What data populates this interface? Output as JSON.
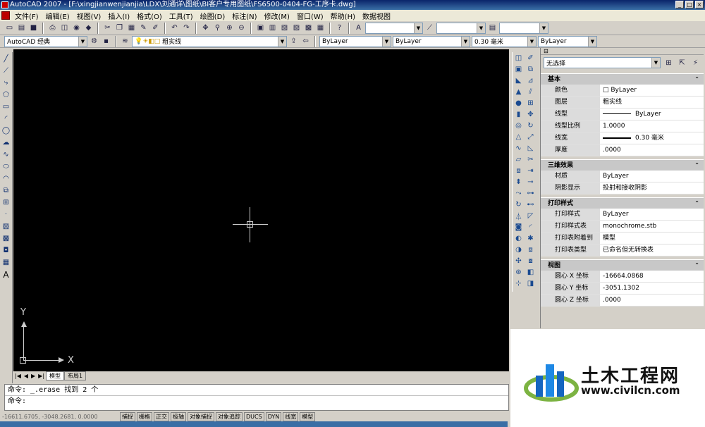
{
  "window": {
    "title": "AutoCAD 2007 - [F:\\xingjianwenjianjia\\LDX\\刘通详\\图纸\\BI客户专用图纸\\FS6500-0404-FG-工序卡.dwg]"
  },
  "menu": [
    "文件(F)",
    "编辑(E)",
    "视图(V)",
    "插入(I)",
    "格式(O)",
    "工具(T)",
    "绘图(D)",
    "标注(N)",
    "修改(M)",
    "窗口(W)",
    "帮助(H)",
    "数据视图"
  ],
  "workspace": {
    "value": "AutoCAD 经典"
  },
  "layer": {
    "value": "粗实线"
  },
  "color_combo": {
    "value": "ByLayer"
  },
  "linetype_combo": {
    "value": "ByLayer"
  },
  "lineweight_combo": {
    "value": "0.30 毫米"
  },
  "plotstyle_combo": {
    "value": "ByLayer"
  },
  "canvas": {
    "ucs_y": "Y",
    "ucs_x": "X"
  },
  "tabs": [
    "模型",
    "布局1"
  ],
  "command": {
    "line1": "命令: _.erase 找到 2 个",
    "line2": "命令:"
  },
  "status": {
    "coords": "-16611.6705, -3048.2681, 0.0000",
    "buttons": [
      "捕捉",
      "栅格",
      "正交",
      "极轴",
      "对象捕捉",
      "对象追踪",
      "DUCS",
      "DYN",
      "线宽",
      "模型"
    ]
  },
  "props": {
    "selection": "无选择",
    "sections": [
      {
        "title": "基本",
        "rows": [
          [
            "颜色",
            "□ ByLayer"
          ],
          [
            "图层",
            "粗实线"
          ],
          [
            "线型",
            "ByLayer"
          ],
          [
            "线型比例",
            "1.0000"
          ],
          [
            "线宽",
            "0.30 毫米"
          ],
          [
            "厚度",
            ".0000"
          ]
        ]
      },
      {
        "title": "三维效果",
        "rows": [
          [
            "材质",
            "ByLayer"
          ],
          [
            "阴影显示",
            "投射和接收阴影"
          ]
        ]
      },
      {
        "title": "打印样式",
        "rows": [
          [
            "打印样式",
            "ByLayer"
          ],
          [
            "打印样式表",
            "monochrome.stb"
          ],
          [
            "打印表附着到",
            "模型"
          ],
          [
            "打印表类型",
            "已命名但无转换表"
          ]
        ]
      },
      {
        "title": "视图",
        "rows": [
          [
            "圆心 X 坐标",
            "-16664.0868"
          ],
          [
            "圆心 Y 坐标",
            "-3051.1302"
          ],
          [
            "圆心 Z 坐标",
            ".0000"
          ]
        ]
      }
    ]
  },
  "watermark": {
    "brand": "土木工程网",
    "url": "www.civilcn.com"
  },
  "colors": {
    "canvas": "#000000",
    "brand_blue": "#1565c0",
    "brand_green": "#7cb342"
  }
}
